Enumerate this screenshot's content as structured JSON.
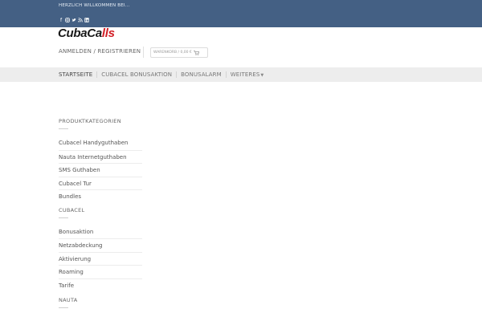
{
  "topbar": {
    "welcome": "HERZLICH WILLKOMMEN BEI...",
    "social_icons": [
      "facebook-icon",
      "instagram-icon",
      "twitter-icon",
      "rss-icon",
      "linkedin-icon"
    ],
    "background": "#446084"
  },
  "logo": {
    "text_main": "CubaCa",
    "text_accent": "lls",
    "accent_color": "#d21f26"
  },
  "header": {
    "account": "ANMELDEN / REGISTRIEREN",
    "cart": "WARENKORB / 0,00 €"
  },
  "nav": {
    "items": [
      {
        "label": "STARTSEITE"
      },
      {
        "label": "CUBACEL BONUSAKTION"
      },
      {
        "label": "BONUSALARM"
      },
      {
        "label": "WEITERES"
      }
    ]
  },
  "sidebar": {
    "widgets": [
      {
        "title": "PRODUKTKATEGORIEN",
        "items": [
          "Cubacel Handyguthaben",
          "Nauta Internetguthaben",
          "SMS Guthaben",
          "Cubacel Tur",
          "Bundles"
        ]
      },
      {
        "title": "CUBACEL",
        "items": [
          "Bonusaktion",
          "Netzabdeckung",
          "Aktivierung",
          "Roaming",
          "Tarife"
        ]
      },
      {
        "title": "NAUTA",
        "items": []
      }
    ]
  }
}
